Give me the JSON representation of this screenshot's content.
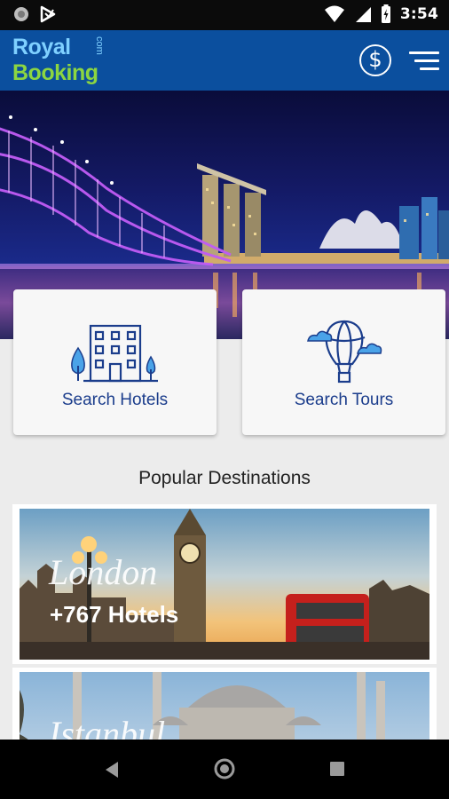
{
  "status_bar": {
    "time": "3:54"
  },
  "logo": {
    "line1": "Royal",
    "line2": "Booking",
    "suffix": "com"
  },
  "header": {
    "currency_symbol": "$"
  },
  "actions": [
    {
      "label": "Search Hotels",
      "icon": "hotel-icon"
    },
    {
      "label": "Search Tours",
      "icon": "hot-air-balloon-icon"
    }
  ],
  "popular": {
    "title": "Popular Destinations",
    "destinations": [
      {
        "name": "London",
        "count": "+767 Hotels"
      },
      {
        "name": "Istanbul",
        "count": ""
      }
    ]
  },
  "colors": {
    "appbar": "#0b4f9e",
    "accent": "#1b3d8c",
    "logo_blue": "#7fd0ff",
    "logo_green": "#8cd641"
  }
}
